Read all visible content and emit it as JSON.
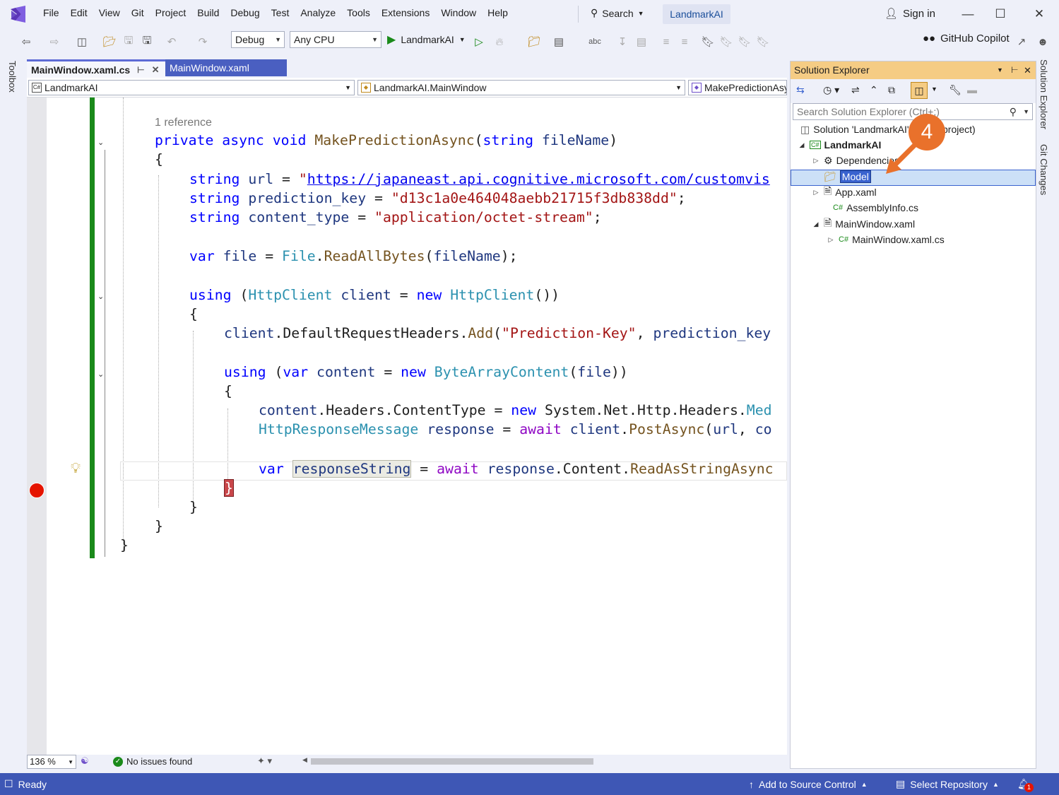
{
  "menubar": {
    "items": [
      "File",
      "Edit",
      "View",
      "Git",
      "Project",
      "Build",
      "Debug",
      "Test",
      "Analyze",
      "Tools",
      "Extensions",
      "Window",
      "Help"
    ],
    "search_label": "Search",
    "title": "LandmarkAI",
    "sign_in": "Sign in"
  },
  "toolbar": {
    "config": "Debug",
    "platform": "Any CPU",
    "run_target": "LandmarkAI",
    "copilot": "GitHub Copilot"
  },
  "side_tabs": {
    "left": "Toolbox",
    "right_top": "Solution Explorer",
    "right_bottom": "Git Changes"
  },
  "tabs": [
    {
      "label": "MainWindow.xaml.cs",
      "active": true
    },
    {
      "label": "MainWindow.xaml",
      "active": false
    }
  ],
  "navbar": {
    "project": "LandmarkAI",
    "class": "LandmarkAI.MainWindow",
    "member": "MakePredictionAsync"
  },
  "code": {
    "reference": "1 reference",
    "sig_kw1": "private",
    "sig_kw2": "async",
    "sig_kw3": "void",
    "sig_method": "MakePredictionAsync",
    "sig_type": "string",
    "sig_param": "fileName",
    "url_var": "url",
    "url_value": "https://japaneast.api.cognitive.microsoft.com/customvis",
    "key_var": "prediction_key",
    "key_value": "\"d13c1a0e464048aebb21715f3db838dd\"",
    "ct_var": "content_type",
    "ct_value": "\"application/octet-stream\"",
    "file_var": "file",
    "file_class": "File",
    "file_method": "ReadAllBytes",
    "using1_kw": "using",
    "httpclient": "HttpClient",
    "client_var": "client",
    "headers_line_a": "client",
    "headers_line_b": ".DefaultRequestHeaders.",
    "headers_method": "Add",
    "headers_string": "\"Prediction-Key\"",
    "headers_tail": "prediction_key",
    "using2_kw": "using",
    "bac_type": "ByteArrayContent",
    "content_var": "content",
    "ct_line_a": "content",
    "ct_line_b": ".Headers.ContentType = ",
    "ct_line_c": "System.Net.Http.Headers.",
    "ct_line_d": "Med",
    "resp_type": "HttpResponseMessage",
    "resp_var": "response",
    "resp_client": "client",
    "resp_method": "PostAsync",
    "resp_url": "url",
    "resp_tail": "co",
    "rs_var": "responseString",
    "rs_resp": "response",
    "rs_mid": ".Content.",
    "rs_method": "ReadAsStringAsync"
  },
  "editor_status": {
    "zoom": "136 %",
    "issues": "No issues found"
  },
  "solution_explorer": {
    "title": "Solution Explorer",
    "search_placeholder": "Search Solution Explorer (Ctrl+;)",
    "solution": "Solution 'LandmarkAI' (1 of 1 project)",
    "project": "LandmarkAI",
    "items": [
      {
        "label": "Dependencies",
        "icon": "dependencies-icon"
      },
      {
        "label": "Model",
        "icon": "folder-icon"
      },
      {
        "label": "App.xaml",
        "icon": "xaml-file-icon"
      },
      {
        "label": "AssemblyInfo.cs",
        "icon": "csharp-file-icon"
      },
      {
        "label": "MainWindow.xaml",
        "icon": "xaml-file-icon"
      },
      {
        "label": "MainWindow.xaml.cs",
        "icon": "csharp-file-icon"
      }
    ],
    "callout": "4"
  },
  "statusbar": {
    "ready": "Ready",
    "source_control": "Add to Source Control",
    "repository": "Select Repository",
    "notifications": "1"
  },
  "colors": {
    "accent": "#5d6bd6",
    "statusbar": "#3e57b5",
    "callout": "#e9712b",
    "panel_header": "#f5cc84"
  }
}
